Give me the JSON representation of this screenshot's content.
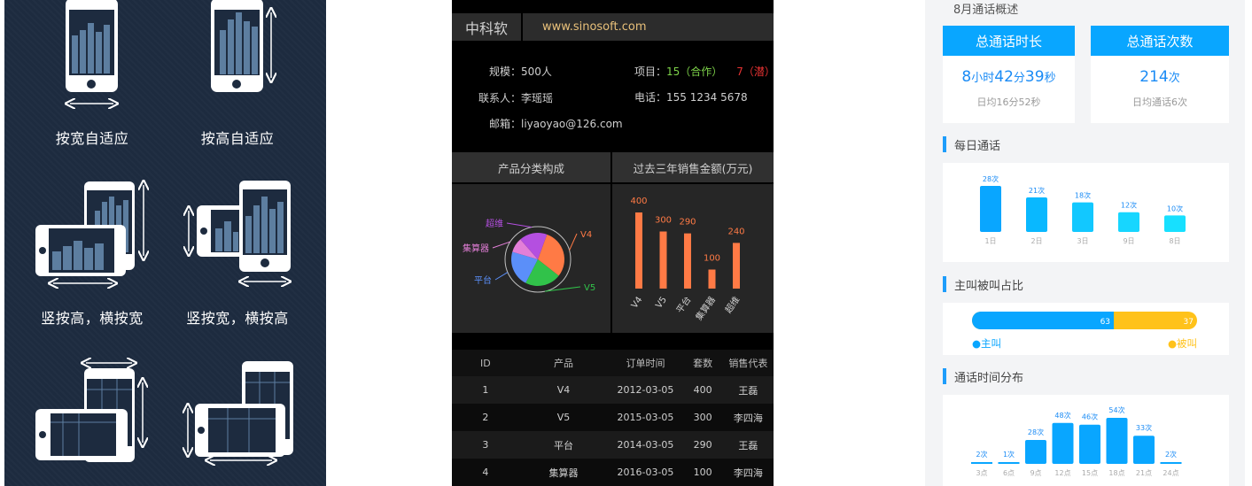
{
  "panel1": {
    "captions": [
      "按宽自适应",
      "按高自适应",
      "竖按高，横按宽",
      "竖按宽，横按高"
    ]
  },
  "panel2": {
    "logo": "中科软",
    "url": "www.sinosoft.com",
    "info": {
      "scale_label": "规模：",
      "scale_value": "500人",
      "project_label": "项目：",
      "project_coop": "15（合作）",
      "project_potential": "7（潜）",
      "contact_label": "联系人：",
      "contact_value": "李瑶瑶",
      "phone_label": "电话：",
      "phone_value": "155  1234  5678",
      "email_label": "邮箱：",
      "email_value": "liyaoyao@126.com"
    },
    "section_titles": [
      "产品分类构成",
      "过去三年销售金额(万元)"
    ],
    "pie_labels": [
      "超维",
      "V4",
      "集算器",
      "平台",
      "V5"
    ],
    "table": {
      "headers": [
        "ID",
        "产品",
        "订单时间",
        "套数",
        "销售代表"
      ],
      "rows": [
        [
          "1",
          "V4",
          "2012-03-05",
          "400",
          "王磊"
        ],
        [
          "2",
          "V5",
          "2015-03-05",
          "300",
          "李四海"
        ],
        [
          "3",
          "平台",
          "2014-03-05",
          "290",
          "王磊"
        ],
        [
          "4",
          "集算器",
          "2016-03-05",
          "100",
          "李四海"
        ]
      ]
    },
    "colors": {
      "accent_orange": "#ff7a45",
      "green": "#7ed34a",
      "red": "#e63232",
      "url": "#e8c07a"
    }
  },
  "panel3": {
    "top_title": "8月通话概述",
    "summary": [
      {
        "head": "总通话时长",
        "big_n1": "8",
        "big_u1": "小时",
        "big_n2": "42",
        "big_u2": "分",
        "big_n3": "39",
        "big_u3": "秒",
        "sub": "日均16分52秒"
      },
      {
        "head": "总通话次数",
        "big_n1": "214",
        "big_u1": "次",
        "sub": "日均通话6次"
      }
    ],
    "daily_title": "每日通话",
    "ratio_title": "主叫被叫占比",
    "ratio": {
      "caller": 63,
      "callee": 37,
      "caller_label": "●主叫",
      "callee_label": "●被叫"
    },
    "dist_title": "通话时间分布",
    "colors": {
      "blue": "#09a6ff",
      "cyan": "#17d6ff",
      "yellow": "#ffc21a",
      "title_bar": "#1e9dfb"
    }
  },
  "chart_data": [
    {
      "type": "pie",
      "title": "产品分类构成",
      "categories": [
        "V4",
        "V5",
        "平台",
        "集算器",
        "超维"
      ],
      "values": [
        30,
        22,
        22,
        9,
        17
      ],
      "colors": [
        "#ff7a45",
        "#31c24a",
        "#5b8ff9",
        "#e37fd8",
        "#b44fe0"
      ]
    },
    {
      "type": "bar",
      "title": "过去三年销售金额(万元)",
      "categories": [
        "V4",
        "V5",
        "平台",
        "集算器",
        "超维"
      ],
      "values": [
        400,
        300,
        290,
        100,
        240
      ],
      "value_labels": [
        "400",
        "300",
        "290",
        "100",
        "240"
      ],
      "ylim": [
        0,
        400
      ],
      "color": "#ff7a45"
    },
    {
      "type": "bar",
      "title": "每日通话",
      "categories": [
        "1日",
        "2日",
        "3日",
        "9日",
        "8日"
      ],
      "values": [
        28,
        21,
        18,
        12,
        10
      ],
      "value_labels": [
        "28次",
        "21次",
        "18次",
        "12次",
        "10次"
      ],
      "ylim": [
        0,
        28
      ]
    },
    {
      "type": "bar",
      "title": "主叫被叫占比",
      "categories": [
        "主叫",
        "被叫"
      ],
      "values": [
        63,
        37
      ]
    },
    {
      "type": "bar",
      "title": "通话时间分布",
      "categories": [
        "3点",
        "6点",
        "9点",
        "12点",
        "15点",
        "18点",
        "21点",
        "24点"
      ],
      "values": [
        2,
        1,
        28,
        48,
        46,
        54,
        33,
        2
      ],
      "value_labels": [
        "2次",
        "1次",
        "28次",
        "48次",
        "46次",
        "54次",
        "33次",
        "2次"
      ],
      "ylim": [
        0,
        54
      ]
    }
  ]
}
